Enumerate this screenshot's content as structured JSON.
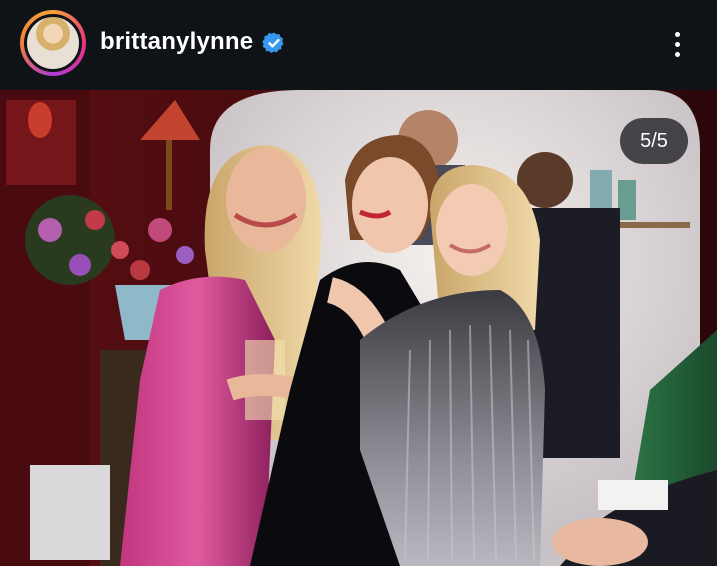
{
  "header": {
    "username": "brittanylynne",
    "avatar_icon": "profile-avatar",
    "verified_icon": "verified-badge-icon",
    "verified_color": "#3897f0",
    "more_icon": "more-options-icon"
  },
  "carousel": {
    "counter": "5/5"
  },
  "colors": {
    "background": "#0f1216",
    "story_ring": [
      "#f9a23a",
      "#e8347d",
      "#b13ad3"
    ]
  }
}
